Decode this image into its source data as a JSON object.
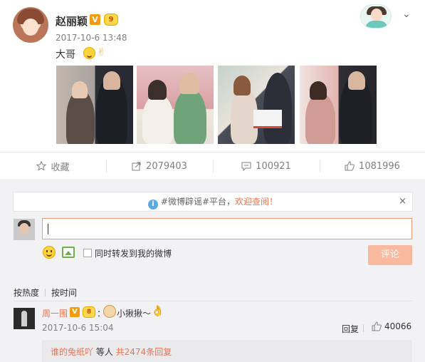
{
  "post": {
    "author": "赵丽颖",
    "verified_label": "V",
    "level_label": "9",
    "time": "2017-10-6 13:48",
    "text": "大哥",
    "photos": [
      "photo-1",
      "photo-2",
      "photo-3",
      "photo-4"
    ]
  },
  "actions": {
    "favorite": "收藏",
    "forward_count": "2079403",
    "comment_count": "100921",
    "like_count": "1081996"
  },
  "notice": {
    "tag": "#微博辟谣#平台，",
    "link": "欢迎查阅！",
    "close": "×"
  },
  "comment_box": {
    "value": "",
    "sync_label": "同时转发到我的微博",
    "submit_label": "评论"
  },
  "sort": {
    "hot": "按热度",
    "time": "按时间"
  },
  "comments": [
    {
      "name": "周一围",
      "verified_label": "V",
      "level_label": "8",
      "colon": "：",
      "text": "小揪揪～",
      "time": "2017-10-6 15:04",
      "reply_label": "回复",
      "likes": "40066",
      "sub": {
        "name": "谁的兔纸吖",
        "mid": " 等人 ",
        "count": "共2474条回复"
      }
    }
  ],
  "colors": {
    "accent": "#eb7350",
    "submit_disabled": "#f9b99e",
    "verified": "#f39c12"
  }
}
